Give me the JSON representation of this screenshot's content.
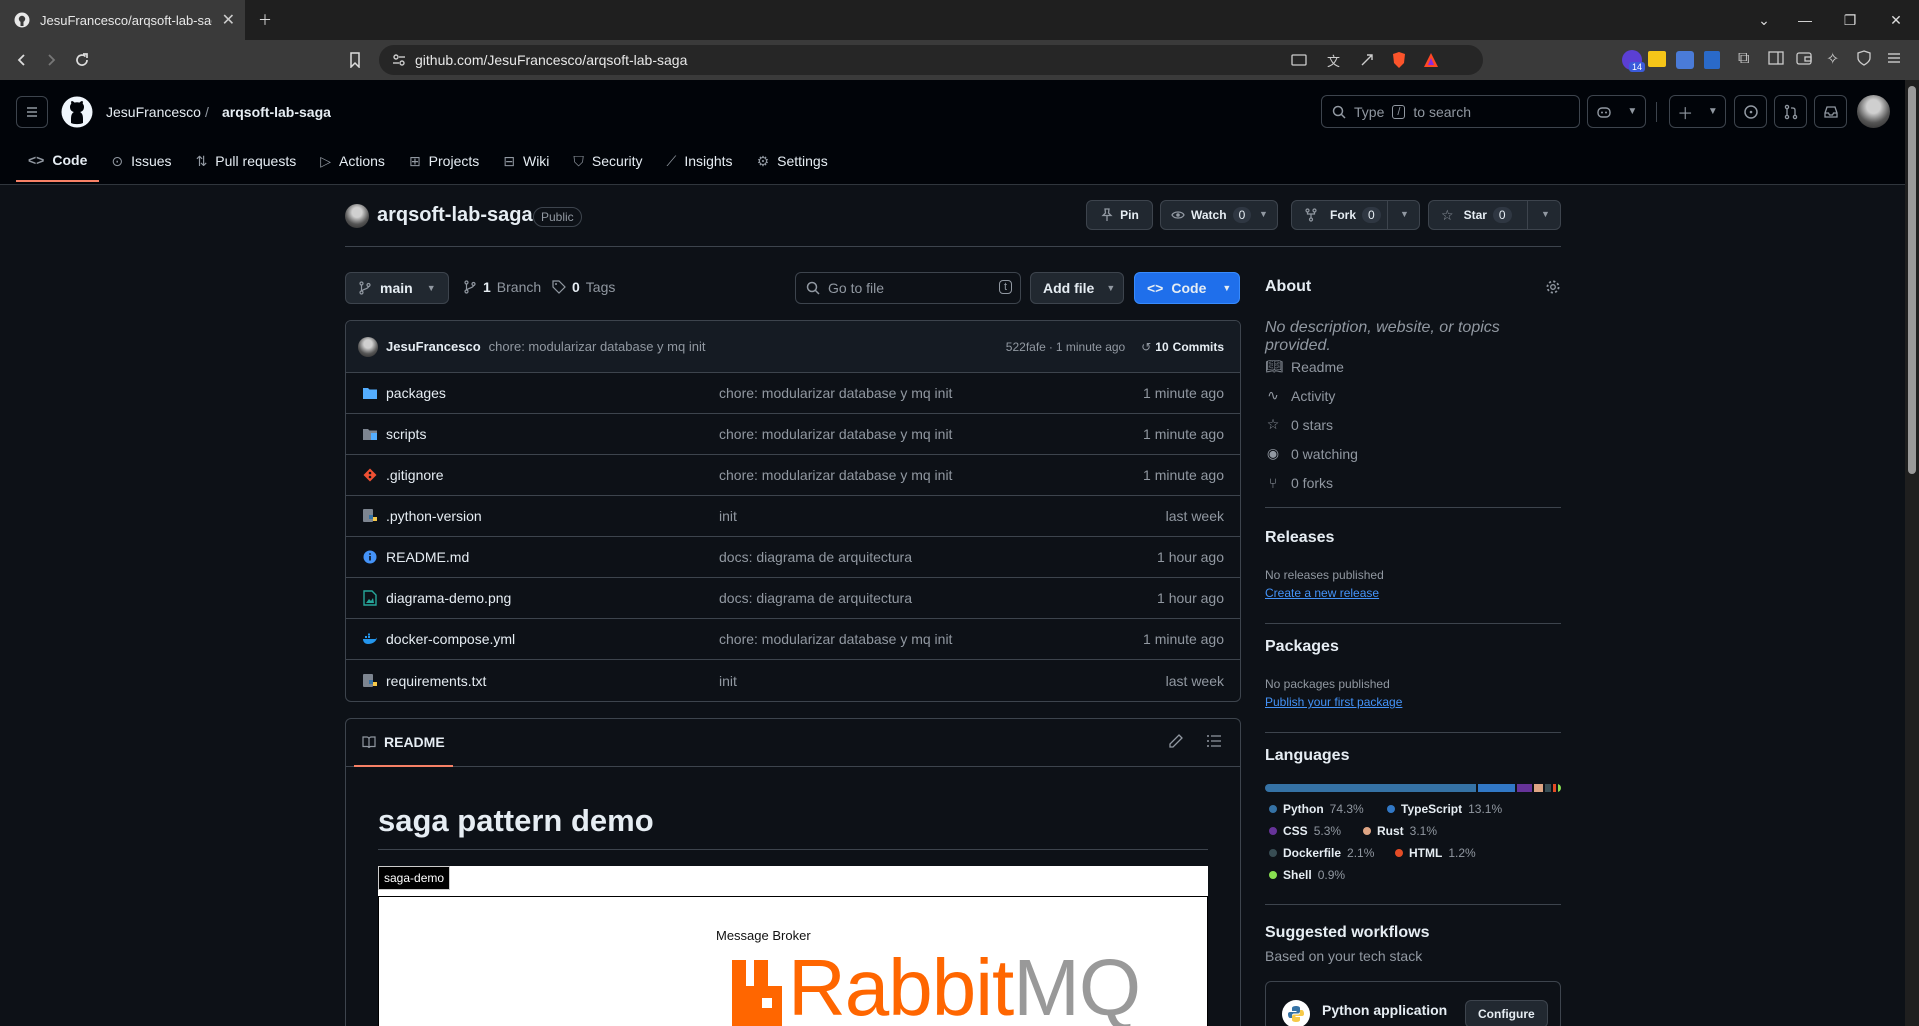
{
  "browser": {
    "tab_title": "JesuFrancesco/arqsoft-lab-saga",
    "url": "github.com/JesuFrancesco/arqsoft-lab-saga",
    "extension_badge": "14"
  },
  "header": {
    "owner": "JesuFrancesco",
    "separator": "/",
    "repo": "arqsoft-lab-saga",
    "search_prefix": "Type",
    "search_key": "/",
    "search_suffix": "to search"
  },
  "repo_tabs": [
    {
      "label": "Code",
      "icon": "code-icon"
    },
    {
      "label": "Issues",
      "icon": "issue-icon"
    },
    {
      "label": "Pull requests",
      "icon": "pull-request-icon"
    },
    {
      "label": "Actions",
      "icon": "play-icon"
    },
    {
      "label": "Projects",
      "icon": "table-icon"
    },
    {
      "label": "Wiki",
      "icon": "book-icon"
    },
    {
      "label": "Security",
      "icon": "shield-icon"
    },
    {
      "label": "Insights",
      "icon": "graph-icon"
    },
    {
      "label": "Settings",
      "icon": "gear-icon"
    }
  ],
  "repo": {
    "name": "arqsoft-lab-saga",
    "visibility": "Public",
    "pin_label": "Pin",
    "watch_label": "Watch",
    "watch_count": "0",
    "fork_label": "Fork",
    "fork_count": "0",
    "star_label": "Star",
    "star_count": "0"
  },
  "toolbar": {
    "branch": "main",
    "branches_count": "1",
    "branches_label": "Branch",
    "tags_count": "0",
    "tags_label": "Tags",
    "goto_placeholder": "Go to file",
    "goto_key": "t",
    "add_file_label": "Add file",
    "code_label": "Code"
  },
  "latest_commit": {
    "author": "JesuFrancesco",
    "message": "chore: modularizar database y mq init",
    "hash": "522fafe",
    "time": "1 minute ago",
    "commits_count": "10",
    "commits_label": "Commits"
  },
  "files": [
    {
      "name": "packages",
      "type": "folder",
      "message": "chore: modularizar database y mq init",
      "date": "1 minute ago"
    },
    {
      "name": "scripts",
      "type": "folder",
      "message": "chore: modularizar database y mq init",
      "date": "1 minute ago"
    },
    {
      "name": ".gitignore",
      "type": "git",
      "message": "chore: modularizar database y mq init",
      "date": "1 minute ago"
    },
    {
      "name": ".python-version",
      "type": "python",
      "message": "init",
      "date": "last week"
    },
    {
      "name": "README.md",
      "type": "info",
      "message": "docs: diagrama de arquitectura",
      "date": "1 hour ago"
    },
    {
      "name": "diagrama-demo.png",
      "type": "image",
      "message": "docs: diagrama de arquitectura",
      "date": "1 hour ago"
    },
    {
      "name": "docker-compose.yml",
      "type": "docker",
      "message": "chore: modularizar database y mq init",
      "date": "1 minute ago"
    },
    {
      "name": "requirements.txt",
      "type": "python",
      "message": "init",
      "date": "last week"
    }
  ],
  "readme": {
    "tab_label": "README",
    "heading": "saga pattern demo",
    "diagram_label": "saga-demo",
    "broker_caption": "Message Broker",
    "logo_text_orange": "Rabbit",
    "logo_text_gray": "MQ"
  },
  "about": {
    "title": "About",
    "description": "No description, website, or topics provided.",
    "items": [
      {
        "icon": "book-icon",
        "label": "Readme"
      },
      {
        "icon": "pulse-icon",
        "label": "Activity"
      },
      {
        "icon": "star-icon",
        "label": "0 stars"
      },
      {
        "icon": "eye-icon",
        "label": "0 watching"
      },
      {
        "icon": "fork-icon",
        "label": "0 forks"
      }
    ]
  },
  "releases": {
    "title": "Releases",
    "empty": "No releases published",
    "link": "Create a new release"
  },
  "packages": {
    "title": "Packages",
    "empty": "No packages published",
    "link": "Publish your first package"
  },
  "languages": {
    "title": "Languages",
    "items": [
      {
        "name": "Python",
        "pct": "74.3%",
        "value": 74.3,
        "color": "#3572A5"
      },
      {
        "name": "TypeScript",
        "pct": "13.1%",
        "value": 13.1,
        "color": "#3178c6"
      },
      {
        "name": "CSS",
        "pct": "5.3%",
        "value": 5.3,
        "color": "#663399"
      },
      {
        "name": "Rust",
        "pct": "3.1%",
        "value": 3.1,
        "color": "#dea584"
      },
      {
        "name": "Dockerfile",
        "pct": "2.1%",
        "value": 2.1,
        "color": "#384d54"
      },
      {
        "name": "HTML",
        "pct": "1.2%",
        "value": 1.2,
        "color": "#e34c26"
      },
      {
        "name": "Shell",
        "pct": "0.9%",
        "value": 0.9,
        "color": "#89e051"
      }
    ]
  },
  "workflows": {
    "title": "Suggested workflows",
    "subtitle": "Based on your tech stack",
    "first_name": "Python application",
    "configure_label": "Configure"
  },
  "colors": {
    "accent_blue": "#1f6feb",
    "link": "#4493f8",
    "tab_underline": "#f78166"
  }
}
